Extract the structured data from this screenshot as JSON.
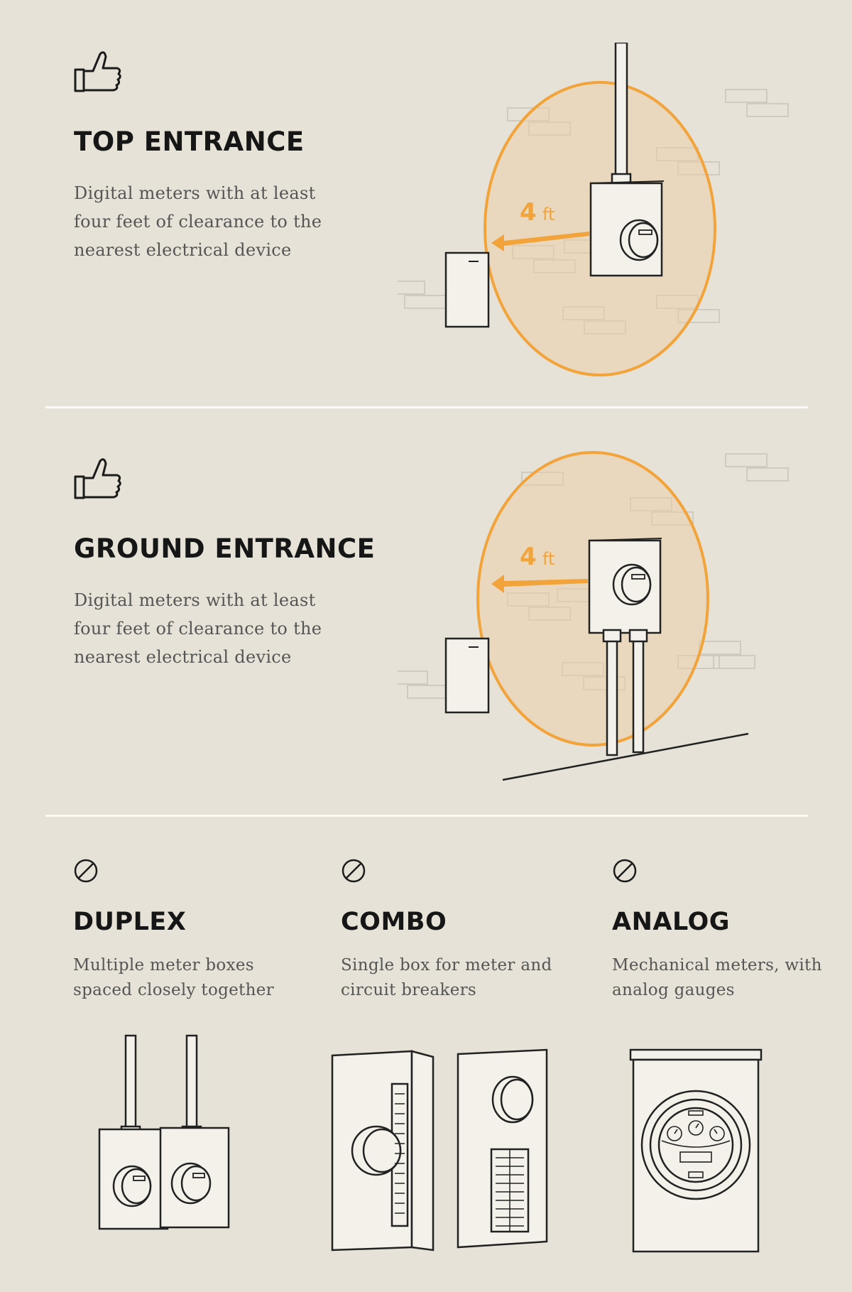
{
  "top_entrance": {
    "title": "TOP ENTRANCE",
    "description": "Digital meters with at least four feet of clearance to the nearest electrical device",
    "icon": "thumbs-up-icon",
    "clearance_label": "4",
    "clearance_unit": "ft"
  },
  "ground_entrance": {
    "title": "GROUND ENTRANCE",
    "description": "Digital meters with at least four feet of clearance to the nearest electrical device",
    "icon": "thumbs-up-icon",
    "clearance_label": "4",
    "clearance_unit": "ft"
  },
  "not_allowed": [
    {
      "title": "DUPLEX",
      "description": "Multiple meter boxes spaced closely together",
      "icon": "prohibited-icon"
    },
    {
      "title": "COMBO",
      "description": "Single box for meter and circuit breakers",
      "icon": "prohibited-icon"
    },
    {
      "title": "ANALOG",
      "description": "Mechanical meters, with analog gauges",
      "icon": "prohibited-icon"
    }
  ],
  "colors": {
    "background": "#e6e2d7",
    "accent": "#f2a33a",
    "accent_fill": "#ebcfa8",
    "divider": "#fbfaf6",
    "text": "#161616"
  }
}
